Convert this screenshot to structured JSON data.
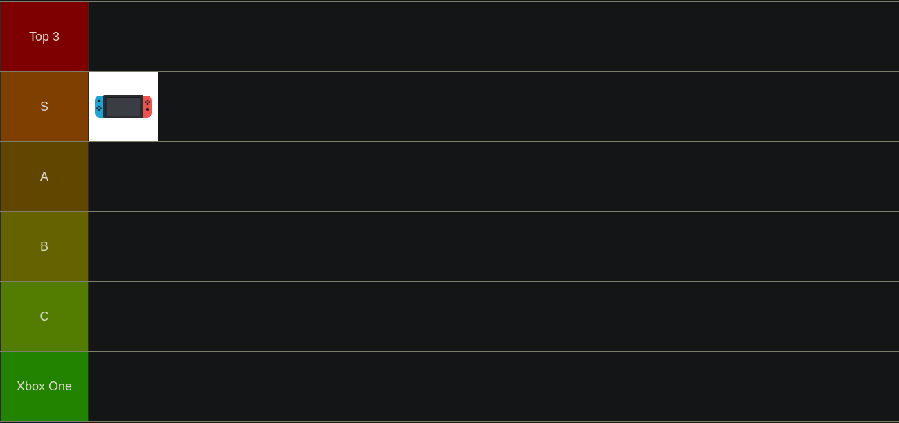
{
  "tiers": [
    {
      "label": "Top 3",
      "color": "#7f0000",
      "items": []
    },
    {
      "label": "S",
      "color": "#7f3f00",
      "items": []
    },
    {
      "label": "A",
      "color": "#614600",
      "items": []
    },
    {
      "label": "B",
      "color": "#656200",
      "items": []
    },
    {
      "label": "C",
      "color": "#527d00",
      "items": []
    },
    {
      "label": "Xbox One",
      "color": "#218300",
      "items": []
    }
  ],
  "s_tier_items": [
    {
      "icon": "nintendo-switch-console-icon",
      "colors": {
        "left_joycon": "#1aa6d9",
        "right_joycon": "#f0524e",
        "body": "#2a2c30",
        "screen": "#3a3d44"
      }
    }
  ]
}
